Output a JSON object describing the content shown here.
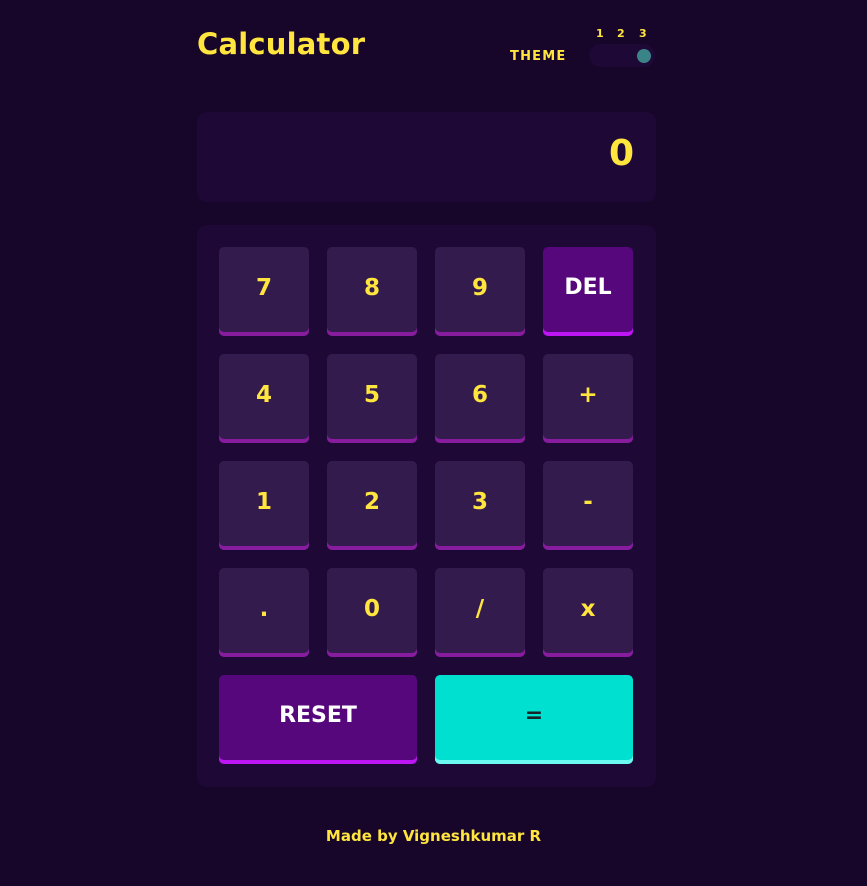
{
  "header": {
    "title": "Calculator",
    "theme_label": "THEME",
    "theme_options": [
      "1",
      "2",
      "3"
    ],
    "selected_theme": "3"
  },
  "display": {
    "value": "0"
  },
  "keypad": {
    "keys": [
      "7",
      "8",
      "9",
      "DEL",
      "4",
      "5",
      "6",
      "+",
      "1",
      "2",
      "3",
      "-",
      ".",
      "0",
      "/",
      "x"
    ],
    "reset_label": "RESET",
    "equals_label": "="
  },
  "footer": {
    "credit": "Made by Vigneshkumar R"
  },
  "colors": {
    "background": "#17062a",
    "panel": "#1e0836",
    "key": "#331c4d",
    "key_shadow": "#881c9e",
    "accent_key": "#56077c",
    "accent_shadow": "#be15f4",
    "equals": "#00e0d1",
    "text_yellow": "#ffe53d",
    "toggle_knob": "#3a8488"
  }
}
